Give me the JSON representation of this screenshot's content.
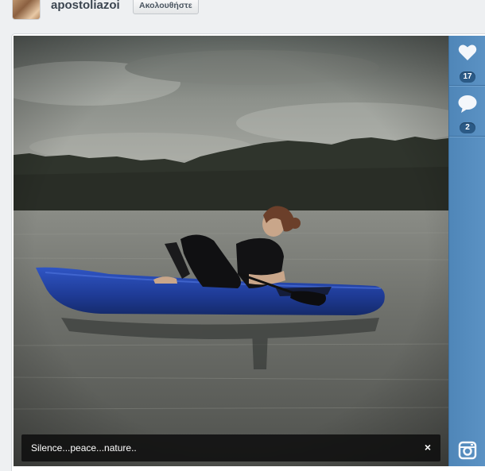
{
  "header": {
    "username": "apostoliazoi",
    "follow_label": "Ακολουθήστε"
  },
  "post": {
    "caption": "Silence...peace...nature..",
    "close_symbol": "×"
  },
  "actions": {
    "likes_count": "17",
    "comments_count": "2"
  },
  "icons": {
    "like": "heart-icon",
    "comment": "speech-bubble-icon",
    "camera": "instagram-camera-icon",
    "close": "close-icon"
  },
  "colors": {
    "rail_blue": "#5b92c4",
    "count_badge": "#2b5a86",
    "kayak_blue": "#1f3f9c"
  }
}
